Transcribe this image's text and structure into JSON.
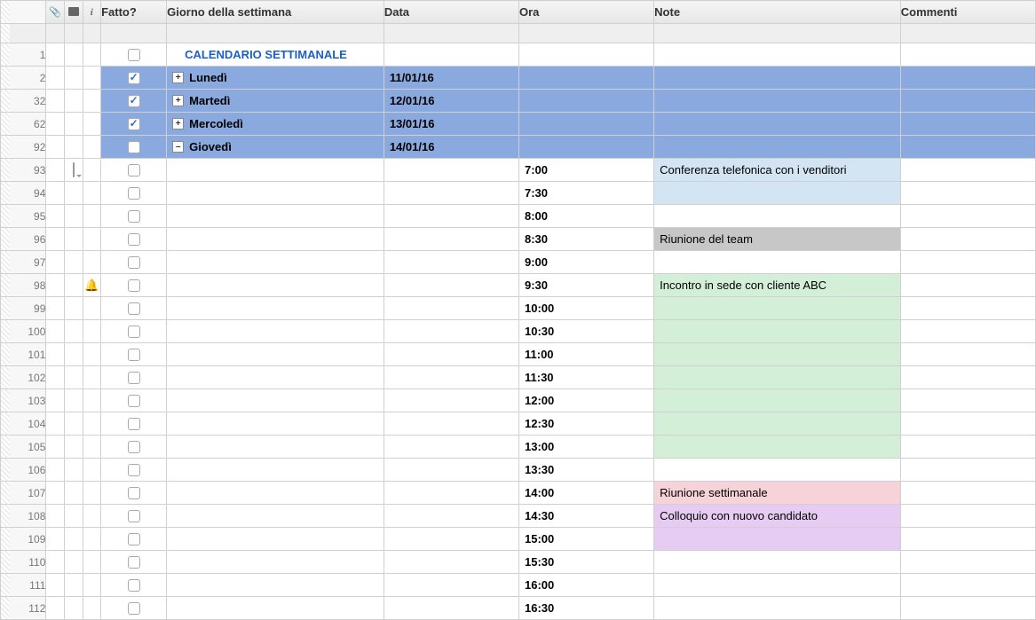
{
  "headers": {
    "fatto": "Fatto?",
    "giorno": "Giorno della settimana",
    "data": "Data",
    "ora": "Ora",
    "note": "Note",
    "commenti": "Commenti"
  },
  "title_row": {
    "num": "1",
    "text": "CALENDARIO SETTIMANALE"
  },
  "day_rows": [
    {
      "num": "2",
      "checked": true,
      "expand": "+",
      "giorno": "Lunedì",
      "data": "11/01/16"
    },
    {
      "num": "32",
      "checked": true,
      "expand": "+",
      "giorno": "Martedì",
      "data": "12/01/16"
    },
    {
      "num": "62",
      "checked": true,
      "expand": "+",
      "giorno": "Mercoledì",
      "data": "13/01/16"
    },
    {
      "num": "92",
      "checked": false,
      "expand": "–",
      "giorno": "Giovedì",
      "data": "14/01/16"
    }
  ],
  "time_rows": [
    {
      "num": "93",
      "ora": "7:00",
      "note": "Conferenza telefonica con i venditori",
      "bg": "bg-lightblue",
      "comment_icon": true
    },
    {
      "num": "94",
      "ora": "7:30",
      "note": "",
      "bg": "bg-lightblue"
    },
    {
      "num": "95",
      "ora": "8:00",
      "note": "",
      "bg": ""
    },
    {
      "num": "96",
      "ora": "8:30",
      "note": "Riunione del team",
      "bg": "bg-gray"
    },
    {
      "num": "97",
      "ora": "9:00",
      "note": "",
      "bg": ""
    },
    {
      "num": "98",
      "ora": "9:30",
      "note": "Incontro in sede con cliente ABC",
      "bg": "bg-green",
      "bell_icon": true
    },
    {
      "num": "99",
      "ora": "10:00",
      "note": "",
      "bg": "bg-green"
    },
    {
      "num": "100",
      "ora": "10:30",
      "note": "",
      "bg": "bg-green"
    },
    {
      "num": "101",
      "ora": "11:00",
      "note": "",
      "bg": "bg-green"
    },
    {
      "num": "102",
      "ora": "11:30",
      "note": "",
      "bg": "bg-green"
    },
    {
      "num": "103",
      "ora": "12:00",
      "note": "",
      "bg": "bg-green"
    },
    {
      "num": "104",
      "ora": "12:30",
      "note": "",
      "bg": "bg-green"
    },
    {
      "num": "105",
      "ora": "13:00",
      "note": "",
      "bg": "bg-green"
    },
    {
      "num": "106",
      "ora": "13:30",
      "note": "",
      "bg": ""
    },
    {
      "num": "107",
      "ora": "14:00",
      "note": "Riunione settimanale",
      "bg": "bg-pink"
    },
    {
      "num": "108",
      "ora": "14:30",
      "note": "Colloquio con nuovo candidato",
      "bg": "bg-purple"
    },
    {
      "num": "109",
      "ora": "15:00",
      "note": "",
      "bg": "bg-purple"
    },
    {
      "num": "110",
      "ora": "15:30",
      "note": "",
      "bg": ""
    },
    {
      "num": "111",
      "ora": "16:00",
      "note": "",
      "bg": ""
    },
    {
      "num": "112",
      "ora": "16:30",
      "note": "",
      "bg": ""
    }
  ]
}
